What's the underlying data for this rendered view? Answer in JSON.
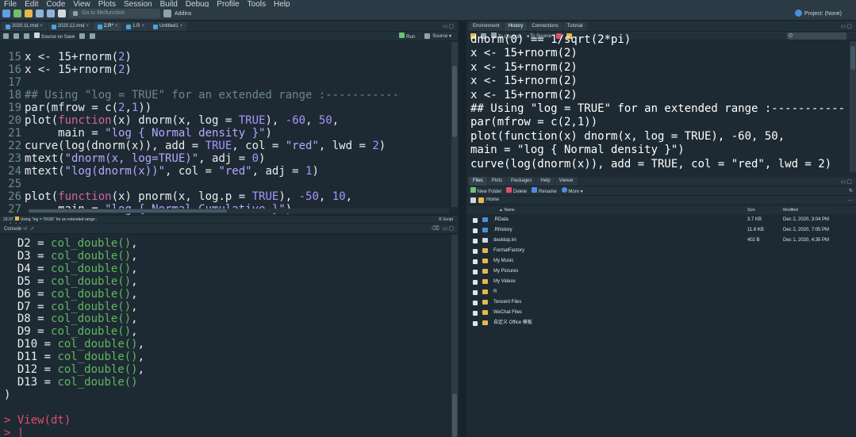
{
  "menu": [
    "File",
    "Edit",
    "Code",
    "View",
    "Plots",
    "Session",
    "Build",
    "Debug",
    "Profile",
    "Tools",
    "Help"
  ],
  "toolbar": {
    "goto_placeholder": "Go to file/function",
    "addins": "Addins",
    "project": "Project: (None)"
  },
  "editor": {
    "tabs": [
      "2020.11.rmd",
      "2020.12.rmd",
      "2.R*",
      "1.R",
      "Untitled1"
    ],
    "source_on_save": "Source on Save",
    "run": "Run",
    "source": "Source",
    "status_pos": "23:37",
    "status_section": "Using \"log = TRUE\" for an extended range :",
    "status_type": "R Script",
    "lines": [
      {
        "n": "15",
        "html": "x <- 15+rnorm(<span class=\"num\">2</span>)"
      },
      {
        "n": "16",
        "html": "x <- 15+rnorm(<span class=\"num\">2</span>)"
      },
      {
        "n": "17",
        "html": ""
      },
      {
        "n": "18",
        "html": "<span class=\"cm\">## Using \"log = TRUE\" for an extended range :-----------</span>"
      },
      {
        "n": "19",
        "html": "par(mfrow = c(<span class=\"num\">2</span>,<span class=\"num\">1</span>))"
      },
      {
        "n": "20",
        "html": "plot(<span class=\"kw\">function</span>(x) dnorm(x, log = <span class=\"bool\">TRUE</span>), <span class=\"num\">-60</span>, <span class=\"num\">50</span>,"
      },
      {
        "n": "21",
        "html": "     main = <span class=\"str\">\"log { Normal density }\"</span>)"
      },
      {
        "n": "22",
        "html": "curve(log(dnorm(x)), add = <span class=\"bool\">TRUE</span>, col = <span class=\"str\">\"red\"</span>, lwd = <span class=\"num\">2</span>)"
      },
      {
        "n": "23",
        "html": "mtext(<span class=\"str\">\"dnorm(x, log=TRUE)\"</span>, adj = <span class=\"num\">0</span>)"
      },
      {
        "n": "24",
        "html": "mtext(<span class=\"str\">\"log(dnorm(x))\"</span>, col = <span class=\"str\">\"red\"</span>, adj = <span class=\"num\">1</span>)"
      },
      {
        "n": "25",
        "html": ""
      },
      {
        "n": "26",
        "html": "plot(<span class=\"kw\">function</span>(x) pnorm(x, log.p = <span class=\"bool\">TRUE</span>), <span class=\"num\">-50</span>, <span class=\"num\">10</span>,"
      },
      {
        "n": "27",
        "html": "     main = <span class=\"str\">\"log { Normal Cumulative }\"</span>)"
      },
      {
        "n": "28",
        "html": ""
      }
    ]
  },
  "console": {
    "title": "Console ~/",
    "lines": [
      "  D2 = <g>col_double()</g>,",
      "  D3 = <g>col_double()</g>,",
      "  D4 = <g>col_double()</g>,",
      "  D5 = <g>col_double()</g>,",
      "  D6 = <g>col_double()</g>,",
      "  D7 = <g>col_double()</g>,",
      "  D8 = <g>col_double()</g>,",
      "  D9 = <g>col_double()</g>,",
      "  D10 = <g>col_double()</g>,",
      "  D11 = <g>col_double()</g>,",
      "  D12 = <g>col_double()</g>,",
      "  D13 = <g>col_double()</g>",
      ")",
      "",
      "<p>> View(dt)</p>",
      "<p>> |</p>"
    ]
  },
  "env": {
    "tabs": [
      "Environment",
      "History",
      "Connections",
      "Tutorial"
    ],
    "to_console": "To Console",
    "to_source": "To Source",
    "lines": [
      "dnorm(0) == 1/sqrt(2*pi)",
      "x <- 15+rnorm(2)",
      "x <- 15+rnorm(2)",
      "x <- 15+rnorm(2)",
      "x <- 15+rnorm(2)",
      "## Using \"log = TRUE\" for an extended range :-----------",
      "par(mfrow = c(2,1))",
      "plot(function(x) dnorm(x, log = TRUE), -60, 50,",
      "main = \"log { Normal density }\")",
      "curve(log(dnorm(x)), add = TRUE, col = \"red\", lwd = 2)"
    ]
  },
  "files": {
    "tabs": [
      "Files",
      "Plots",
      "Packages",
      "Help",
      "Viewer"
    ],
    "new_folder": "New Folder",
    "delete": "Delete",
    "rename": "Rename",
    "more": "More",
    "breadcrumb": "Home",
    "headers": {
      "name": "Name",
      "size": "Size",
      "modified": "Modified"
    },
    "rows": [
      {
        "name": ".RData",
        "size": "3.7 KB",
        "modified": "Dec 2, 2020, 3:04 PM",
        "kind": "rfile"
      },
      {
        "name": ".Rhistory",
        "size": "11.6 KB",
        "modified": "Dec 2, 2020, 7:05 PM",
        "kind": "rfile"
      },
      {
        "name": "desktop.ini",
        "size": "402 B",
        "modified": "Dec 1, 2020, 4:35 PM",
        "kind": "docf"
      },
      {
        "name": "FormatFactory",
        "size": "",
        "modified": "",
        "kind": "folder"
      },
      {
        "name": "My Music",
        "size": "",
        "modified": "",
        "kind": "folder"
      },
      {
        "name": "My Pictures",
        "size": "",
        "modified": "",
        "kind": "folder"
      },
      {
        "name": "My Videos",
        "size": "",
        "modified": "",
        "kind": "folder"
      },
      {
        "name": "R",
        "size": "",
        "modified": "",
        "kind": "folder"
      },
      {
        "name": "Tencent Files",
        "size": "",
        "modified": "",
        "kind": "folder"
      },
      {
        "name": "WeChat Files",
        "size": "",
        "modified": "",
        "kind": "folder"
      },
      {
        "name": "自定义 Office 模板",
        "size": "",
        "modified": "",
        "kind": "folder"
      }
    ]
  }
}
